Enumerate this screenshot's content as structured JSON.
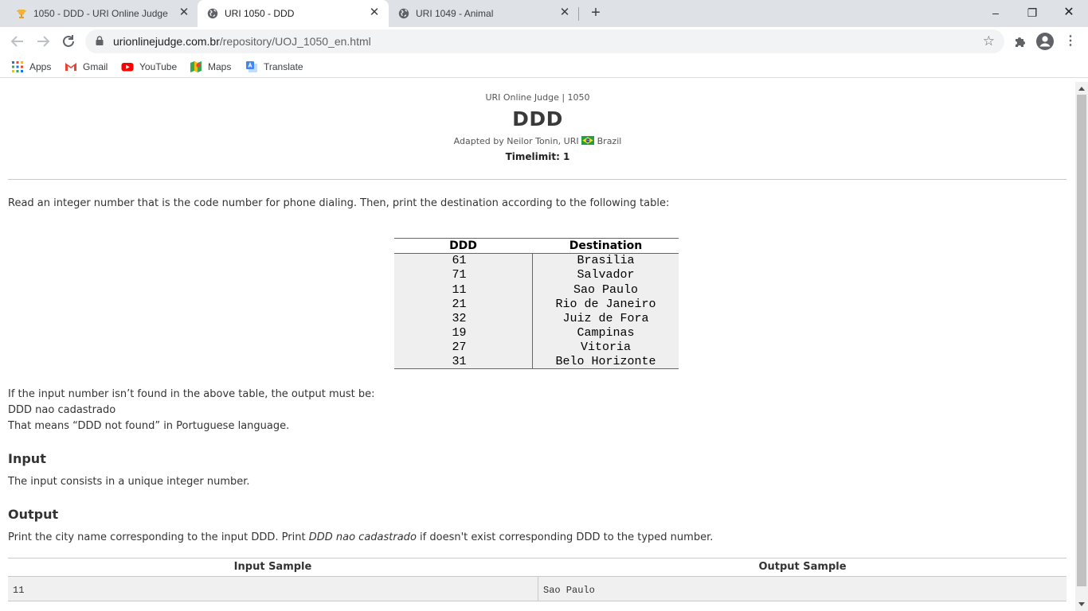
{
  "browser": {
    "tabs": [
      {
        "title": "1050 - DDD - URI Online Judge",
        "favicon": "uri-trophy-icon",
        "active": false
      },
      {
        "title": "URI 1050 - DDD",
        "favicon": "globe-icon",
        "active": true
      },
      {
        "title": "URI 1049 - Animal",
        "favicon": "globe-icon",
        "active": false
      }
    ],
    "new_tab": "+",
    "window_controls": {
      "minimize": "–",
      "restore": "❐",
      "close": "✕"
    },
    "url_host": "urionlinejudge.com.br",
    "url_path": "/repository/UOJ_1050_en.html",
    "bookmarks": [
      {
        "label": "Apps",
        "icon": "apps-grid-icon"
      },
      {
        "label": "Gmail",
        "icon": "gmail-icon"
      },
      {
        "label": "YouTube",
        "icon": "youtube-icon"
      },
      {
        "label": "Maps",
        "icon": "maps-icon"
      },
      {
        "label": "Translate",
        "icon": "translate-icon"
      }
    ],
    "colors": {
      "tabstrip": "#dee1e6",
      "omnibox": "#f1f3f4"
    }
  },
  "problem": {
    "judge_line": "URI Online Judge | 1050",
    "title": "DDD",
    "adapted_by": "Adapted by Neilor Tonin, URI",
    "country": "Brazil",
    "timelimit": "Timelimit: 1",
    "intro": "Read an integer number that is the code number for phone dialing. Then, print the destination according to the following table:",
    "table": {
      "headers": [
        "DDD",
        "Destination"
      ],
      "rows": [
        [
          "61",
          "Brasilia"
        ],
        [
          "71",
          "Salvador"
        ],
        [
          "11",
          "Sao Paulo"
        ],
        [
          "21",
          "Rio de Janeiro"
        ],
        [
          "32",
          "Juiz de Fora"
        ],
        [
          "19",
          "Campinas"
        ],
        [
          "27",
          "Vitoria"
        ],
        [
          "31",
          "Belo Horizonte"
        ]
      ]
    },
    "not_found_line": "If the input number isn’t found in the above table, the output must be:",
    "not_found_value": "DDD nao cadastrado",
    "meaning_line": "That means “DDD not found” in Portuguese language.",
    "input_heading": "Input",
    "input_text": "The input consists in a unique integer number.",
    "output_heading": "Output",
    "output_text_before": "Print the city name corresponding to the input DDD. Print ",
    "output_text_em": "DDD nao cadastrado",
    "output_text_after": " if doesn't exist corresponding DDD to the typed number.",
    "samples": {
      "input_header": "Input Sample",
      "output_header": "Output Sample",
      "input_value": "11",
      "output_value": "Sao Paulo"
    }
  }
}
